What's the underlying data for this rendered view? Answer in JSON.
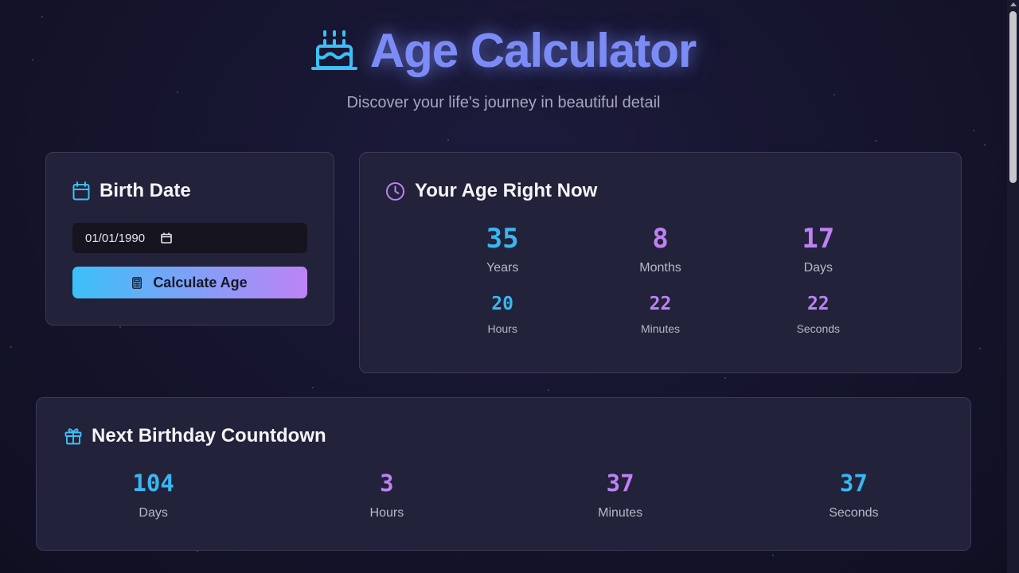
{
  "header": {
    "title": "Age Calculator",
    "subtitle": "Discover your life's journey in beautiful detail",
    "icon": "birthday-cake-icon"
  },
  "birth_card": {
    "title": "Birth Date",
    "icon": "calendar-icon",
    "date_value": "01/01/1990",
    "button_label": "Calculate Age",
    "button_icon": "calculator-icon"
  },
  "age_card": {
    "title": "Your Age Right Now",
    "icon": "clock-icon",
    "years": {
      "value": "35",
      "label": "Years"
    },
    "months": {
      "value": "8",
      "label": "Months"
    },
    "days": {
      "value": "17",
      "label": "Days"
    },
    "hours": {
      "value": "20",
      "label": "Hours"
    },
    "minutes": {
      "value": "22",
      "label": "Minutes"
    },
    "seconds": {
      "value": "22",
      "label": "Seconds"
    }
  },
  "countdown_card": {
    "title": "Next Birthday Countdown",
    "icon": "gift-icon",
    "days": {
      "value": "104",
      "label": "Days"
    },
    "hours": {
      "value": "3",
      "label": "Hours"
    },
    "minutes": {
      "value": "37",
      "label": "Minutes"
    },
    "seconds": {
      "value": "37",
      "label": "Seconds"
    }
  },
  "colors": {
    "accent_cyan": "#39b7f0",
    "accent_violet": "#bd82f2",
    "title_blue": "#7c8cf6",
    "background": "#15142c",
    "card": "#22223a"
  }
}
